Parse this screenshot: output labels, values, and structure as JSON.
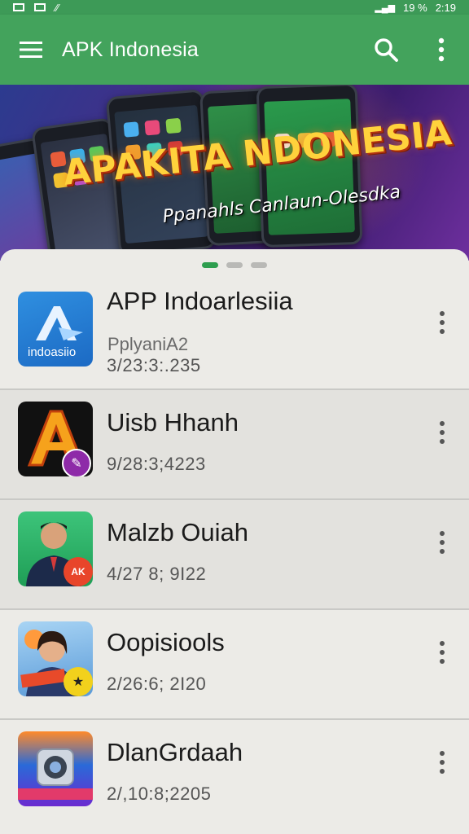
{
  "status_bar": {
    "time": "2:19",
    "battery": "19 %"
  },
  "app_bar": {
    "title": "APK Indonesia"
  },
  "banner": {
    "title": "APAKITA NDONESIA",
    "subtitle": "Ppanahls Canlaun-Olesdka"
  },
  "carousel": {
    "pages": 3,
    "active": 0
  },
  "apps": [
    {
      "title": "APP Indoarlesiia",
      "subtitle": "PplyaniA2",
      "date": "3/23:3:.235",
      "icon_label": "indoasiio"
    },
    {
      "title": "Uisb Hhanh",
      "subtitle": "",
      "date": "9/28:3;4223"
    },
    {
      "title": "Malzb Ouiah",
      "subtitle": "",
      "date": "4/27  8; 9I22"
    },
    {
      "title": "Oopisiools",
      "subtitle": "",
      "date": "2/26:6; 2I20"
    },
    {
      "title": "DlanGrdaah",
      "subtitle": "",
      "date": "2/,10:8;2205"
    }
  ],
  "colors": {
    "primary": "#43a35c",
    "accent": "#2e9e4f",
    "background": "#ecebe7"
  }
}
